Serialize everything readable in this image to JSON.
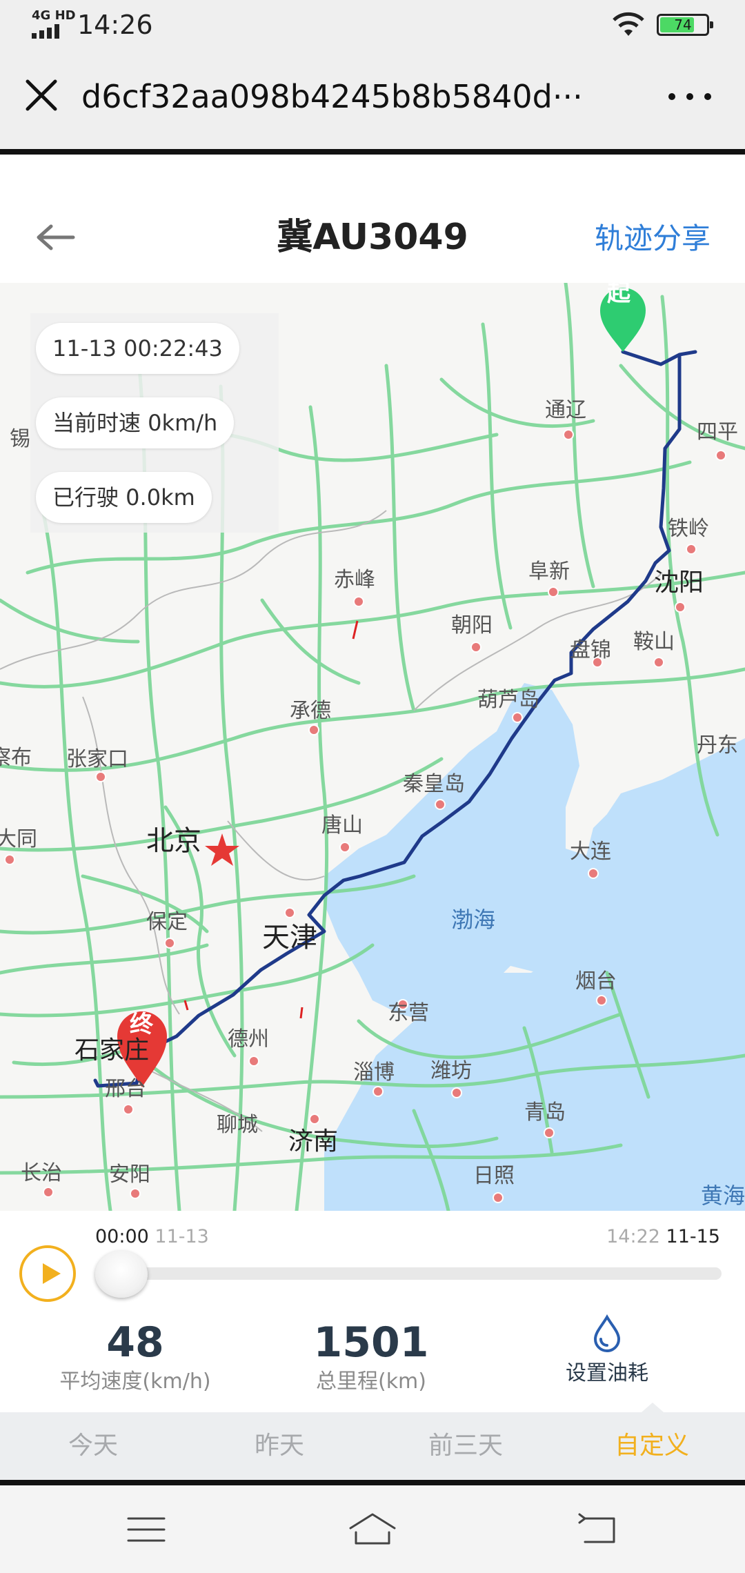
{
  "status_bar": {
    "network": "4G HD",
    "time": "14:26",
    "battery": "74",
    "battery_level": 0.74
  },
  "browser": {
    "url": "d6cf32aa098b4245b8b5840d···"
  },
  "header": {
    "title": "冀AU3049",
    "share_label": "轨迹分享"
  },
  "info_panel": {
    "timestamp": "11-13 00:22:43",
    "speed": "当前时速 0km/h",
    "distance": "已行驶 0.0km"
  },
  "map": {
    "start_marker": "起",
    "end_marker": "终",
    "places": {
      "tongliao": "通辽",
      "siping": "四平",
      "tieling": "铁岭",
      "shenyang": "沈阳",
      "fuxin": "阜新",
      "chifeng": "赤峰",
      "chaoyang": "朝阳",
      "panjin": "盘锦",
      "anshan": "鞍山",
      "huludao": "葫芦岛",
      "chengde": "承德",
      "zhangjiakou": "张家口",
      "dandong": "丹东",
      "beijing": "北京",
      "qinhuangdao": "秦皇岛",
      "tangshan": "唐山",
      "dalian": "大连",
      "baoding": "保定",
      "tianjin": "天津",
      "bohai": "渤海",
      "yantai": "烟台",
      "dongying": "东营",
      "shijiazhuang": "石家庄",
      "dezhou": "德州",
      "zibo": "淄博",
      "weifang": "潍坊",
      "xingtai": "邢台",
      "qingdao": "青岛",
      "liaocheng": "聊城",
      "jinan": "济南",
      "changzhi": "长治",
      "anyang": "安阳",
      "rizhao": "日照",
      "huanghai": "黄海",
      "datong": "大同",
      "edge_left_top": "锡",
      "edge_left_mid": "察布"
    }
  },
  "playback": {
    "start_time": "00:00",
    "start_date": "11-13",
    "end_time": "14:22",
    "end_date": "11-15",
    "progress": 0
  },
  "stats": {
    "avg_speed_value": "48",
    "avg_speed_label": "平均速度(km/h)",
    "total_distance_value": "1501",
    "total_distance_label": "总里程(km)",
    "fuel_label": "设置油耗"
  },
  "tabs": [
    {
      "label": "今天"
    },
    {
      "label": "昨天"
    },
    {
      "label": "前三天"
    },
    {
      "label": "自定义"
    }
  ],
  "colors": {
    "accent": "#f2b01e",
    "link": "#2f7ed8",
    "route": "#1f3a8a",
    "roads": "#7fd79a",
    "sea": "#bfe0fb"
  }
}
